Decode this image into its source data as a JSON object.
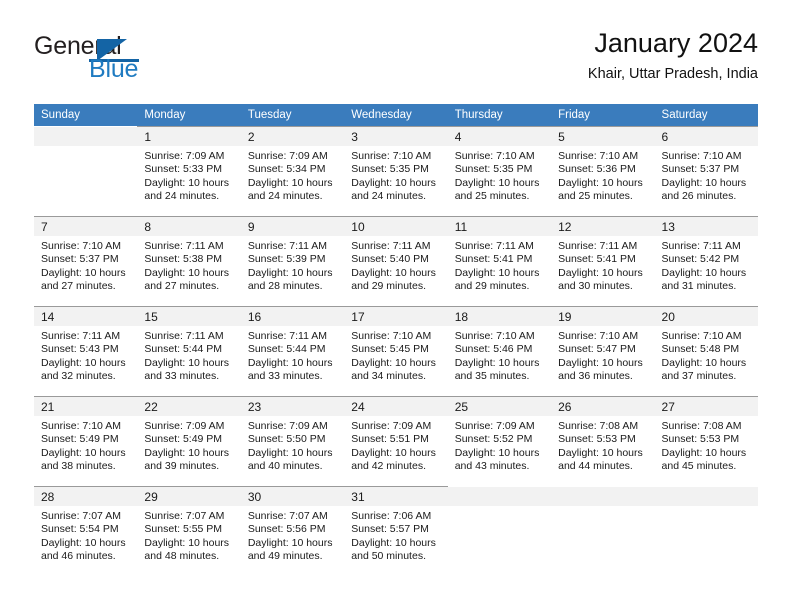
{
  "brand": {
    "name_part1": "General",
    "name_part2": "Blue",
    "triangle_icon": "triangle-icon"
  },
  "header": {
    "title": "January 2024",
    "location": "Khair, Uttar Pradesh, India"
  },
  "colors": {
    "header_row": "#3a7cbd",
    "day_number_bar": "#f2f2f2",
    "brand_blue": "#1f7bc1",
    "logo_accent": "#1464a5",
    "text": "#1a1a1a"
  },
  "weekday_headers": [
    "Sunday",
    "Monday",
    "Tuesday",
    "Wednesday",
    "Thursday",
    "Friday",
    "Saturday"
  ],
  "labels": {
    "sunrise_prefix": "Sunrise: ",
    "sunset_prefix": "Sunset: ",
    "daylight_prefix": "Daylight: "
  },
  "weeks": [
    [
      {
        "day": "",
        "sunrise": "",
        "sunset": "",
        "daylight_line1": "",
        "daylight_line2": "",
        "empty": true
      },
      {
        "day": "1",
        "sunrise": "Sunrise: 7:09 AM",
        "sunset": "Sunset: 5:33 PM",
        "daylight_line1": "Daylight: 10 hours",
        "daylight_line2": "and 24 minutes.",
        "empty": false
      },
      {
        "day": "2",
        "sunrise": "Sunrise: 7:09 AM",
        "sunset": "Sunset: 5:34 PM",
        "daylight_line1": "Daylight: 10 hours",
        "daylight_line2": "and 24 minutes.",
        "empty": false
      },
      {
        "day": "3",
        "sunrise": "Sunrise: 7:10 AM",
        "sunset": "Sunset: 5:35 PM",
        "daylight_line1": "Daylight: 10 hours",
        "daylight_line2": "and 24 minutes.",
        "empty": false
      },
      {
        "day": "4",
        "sunrise": "Sunrise: 7:10 AM",
        "sunset": "Sunset: 5:35 PM",
        "daylight_line1": "Daylight: 10 hours",
        "daylight_line2": "and 25 minutes.",
        "empty": false
      },
      {
        "day": "5",
        "sunrise": "Sunrise: 7:10 AM",
        "sunset": "Sunset: 5:36 PM",
        "daylight_line1": "Daylight: 10 hours",
        "daylight_line2": "and 25 minutes.",
        "empty": false
      },
      {
        "day": "6",
        "sunrise": "Sunrise: 7:10 AM",
        "sunset": "Sunset: 5:37 PM",
        "daylight_line1": "Daylight: 10 hours",
        "daylight_line2": "and 26 minutes.",
        "empty": false
      }
    ],
    [
      {
        "day": "7",
        "sunrise": "Sunrise: 7:10 AM",
        "sunset": "Sunset: 5:37 PM",
        "daylight_line1": "Daylight: 10 hours",
        "daylight_line2": "and 27 minutes.",
        "empty": false
      },
      {
        "day": "8",
        "sunrise": "Sunrise: 7:11 AM",
        "sunset": "Sunset: 5:38 PM",
        "daylight_line1": "Daylight: 10 hours",
        "daylight_line2": "and 27 minutes.",
        "empty": false
      },
      {
        "day": "9",
        "sunrise": "Sunrise: 7:11 AM",
        "sunset": "Sunset: 5:39 PM",
        "daylight_line1": "Daylight: 10 hours",
        "daylight_line2": "and 28 minutes.",
        "empty": false
      },
      {
        "day": "10",
        "sunrise": "Sunrise: 7:11 AM",
        "sunset": "Sunset: 5:40 PM",
        "daylight_line1": "Daylight: 10 hours",
        "daylight_line2": "and 29 minutes.",
        "empty": false
      },
      {
        "day": "11",
        "sunrise": "Sunrise: 7:11 AM",
        "sunset": "Sunset: 5:41 PM",
        "daylight_line1": "Daylight: 10 hours",
        "daylight_line2": "and 29 minutes.",
        "empty": false
      },
      {
        "day": "12",
        "sunrise": "Sunrise: 7:11 AM",
        "sunset": "Sunset: 5:41 PM",
        "daylight_line1": "Daylight: 10 hours",
        "daylight_line2": "and 30 minutes.",
        "empty": false
      },
      {
        "day": "13",
        "sunrise": "Sunrise: 7:11 AM",
        "sunset": "Sunset: 5:42 PM",
        "daylight_line1": "Daylight: 10 hours",
        "daylight_line2": "and 31 minutes.",
        "empty": false
      }
    ],
    [
      {
        "day": "14",
        "sunrise": "Sunrise: 7:11 AM",
        "sunset": "Sunset: 5:43 PM",
        "daylight_line1": "Daylight: 10 hours",
        "daylight_line2": "and 32 minutes.",
        "empty": false
      },
      {
        "day": "15",
        "sunrise": "Sunrise: 7:11 AM",
        "sunset": "Sunset: 5:44 PM",
        "daylight_line1": "Daylight: 10 hours",
        "daylight_line2": "and 33 minutes.",
        "empty": false
      },
      {
        "day": "16",
        "sunrise": "Sunrise: 7:11 AM",
        "sunset": "Sunset: 5:44 PM",
        "daylight_line1": "Daylight: 10 hours",
        "daylight_line2": "and 33 minutes.",
        "empty": false
      },
      {
        "day": "17",
        "sunrise": "Sunrise: 7:10 AM",
        "sunset": "Sunset: 5:45 PM",
        "daylight_line1": "Daylight: 10 hours",
        "daylight_line2": "and 34 minutes.",
        "empty": false
      },
      {
        "day": "18",
        "sunrise": "Sunrise: 7:10 AM",
        "sunset": "Sunset: 5:46 PM",
        "daylight_line1": "Daylight: 10 hours",
        "daylight_line2": "and 35 minutes.",
        "empty": false
      },
      {
        "day": "19",
        "sunrise": "Sunrise: 7:10 AM",
        "sunset": "Sunset: 5:47 PM",
        "daylight_line1": "Daylight: 10 hours",
        "daylight_line2": "and 36 minutes.",
        "empty": false
      },
      {
        "day": "20",
        "sunrise": "Sunrise: 7:10 AM",
        "sunset": "Sunset: 5:48 PM",
        "daylight_line1": "Daylight: 10 hours",
        "daylight_line2": "and 37 minutes.",
        "empty": false
      }
    ],
    [
      {
        "day": "21",
        "sunrise": "Sunrise: 7:10 AM",
        "sunset": "Sunset: 5:49 PM",
        "daylight_line1": "Daylight: 10 hours",
        "daylight_line2": "and 38 minutes.",
        "empty": false
      },
      {
        "day": "22",
        "sunrise": "Sunrise: 7:09 AM",
        "sunset": "Sunset: 5:49 PM",
        "daylight_line1": "Daylight: 10 hours",
        "daylight_line2": "and 39 minutes.",
        "empty": false
      },
      {
        "day": "23",
        "sunrise": "Sunrise: 7:09 AM",
        "sunset": "Sunset: 5:50 PM",
        "daylight_line1": "Daylight: 10 hours",
        "daylight_line2": "and 40 minutes.",
        "empty": false
      },
      {
        "day": "24",
        "sunrise": "Sunrise: 7:09 AM",
        "sunset": "Sunset: 5:51 PM",
        "daylight_line1": "Daylight: 10 hours",
        "daylight_line2": "and 42 minutes.",
        "empty": false
      },
      {
        "day": "25",
        "sunrise": "Sunrise: 7:09 AM",
        "sunset": "Sunset: 5:52 PM",
        "daylight_line1": "Daylight: 10 hours",
        "daylight_line2": "and 43 minutes.",
        "empty": false
      },
      {
        "day": "26",
        "sunrise": "Sunrise: 7:08 AM",
        "sunset": "Sunset: 5:53 PM",
        "daylight_line1": "Daylight: 10 hours",
        "daylight_line2": "and 44 minutes.",
        "empty": false
      },
      {
        "day": "27",
        "sunrise": "Sunrise: 7:08 AM",
        "sunset": "Sunset: 5:53 PM",
        "daylight_line1": "Daylight: 10 hours",
        "daylight_line2": "and 45 minutes.",
        "empty": false
      }
    ],
    [
      {
        "day": "28",
        "sunrise": "Sunrise: 7:07 AM",
        "sunset": "Sunset: 5:54 PM",
        "daylight_line1": "Daylight: 10 hours",
        "daylight_line2": "and 46 minutes.",
        "empty": false
      },
      {
        "day": "29",
        "sunrise": "Sunrise: 7:07 AM",
        "sunset": "Sunset: 5:55 PM",
        "daylight_line1": "Daylight: 10 hours",
        "daylight_line2": "and 48 minutes.",
        "empty": false
      },
      {
        "day": "30",
        "sunrise": "Sunrise: 7:07 AM",
        "sunset": "Sunset: 5:56 PM",
        "daylight_line1": "Daylight: 10 hours",
        "daylight_line2": "and 49 minutes.",
        "empty": false
      },
      {
        "day": "31",
        "sunrise": "Sunrise: 7:06 AM",
        "sunset": "Sunset: 5:57 PM",
        "daylight_line1": "Daylight: 10 hours",
        "daylight_line2": "and 50 minutes.",
        "empty": false
      },
      {
        "day": "",
        "sunrise": "",
        "sunset": "",
        "daylight_line1": "",
        "daylight_line2": "",
        "empty": true
      },
      {
        "day": "",
        "sunrise": "",
        "sunset": "",
        "daylight_line1": "",
        "daylight_line2": "",
        "empty": true
      },
      {
        "day": "",
        "sunrise": "",
        "sunset": "",
        "daylight_line1": "",
        "daylight_line2": "",
        "empty": true
      }
    ]
  ]
}
